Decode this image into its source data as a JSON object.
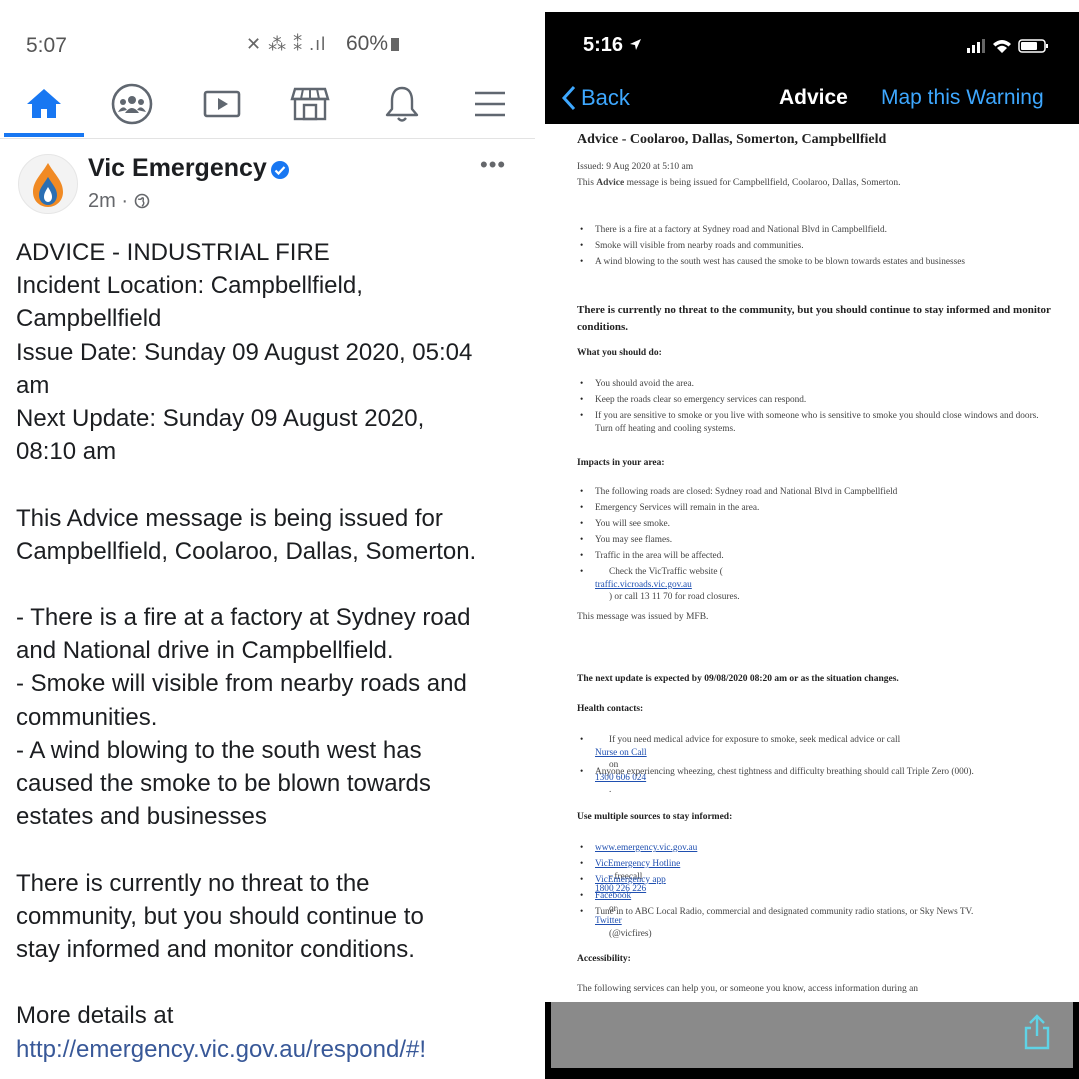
{
  "left": {
    "status": {
      "time": "5:07",
      "icons": "✕ ⁂ ⁑ .ıl",
      "battery": "60%"
    },
    "nav": [
      "home-icon",
      "groups-icon",
      "watch-icon",
      "marketplace-icon",
      "notifications-icon",
      "menu-icon"
    ],
    "post": {
      "page_name": "Vic Emergency",
      "time": "2m · ",
      "more": "•••",
      "lines": [
        "ADVICE - INDUSTRIAL FIRE",
        "Incident Location: Campbellfield,",
        "Campbellfield",
        "Issue Date: Sunday 09 August 2020, 05:04",
        "am",
        "Next Update: Sunday 09 August 2020,",
        "08:10 am",
        "",
        "This Advice message is being issued for",
        "Campbellfield, Coolaroo, Dallas, Somerton.",
        "",
        "- There is a fire at a factory at  Sydney road",
        "and National drive in Campbellfield.",
        "- Smoke will visible from nearby roads and",
        "communities.",
        "- A wind blowing to the south west has",
        "caused the smoke to be blown towards",
        "estates and businesses",
        "",
        "There is currently no threat to the",
        "community, but you should continue to",
        "stay informed and monitor conditions.",
        "",
        "More details at"
      ],
      "link": "http://emergency.vic.gov.au/respond/#!"
    }
  },
  "right": {
    "status": {
      "time": "5:16"
    },
    "nav": {
      "back": "Back",
      "title": "Advice",
      "map": "Map this Warning"
    },
    "doc": {
      "title": "Advice - Coolaroo, Dallas, Somerton, Campbellfield",
      "issued": "Issued: 9 Aug 2020 at 5:10 am",
      "issued_line2_pre": "This ",
      "issued_line2_bold": "Advice",
      "issued_line2_post": " message is being issued for Campbellfield, Coolaroo, Dallas, Somerton.",
      "bullets1": [
        "There is a fire at a factory at  Sydney road and National Blvd in Campbellfield.",
        "Smoke will visible from nearby roads and communities.",
        "A wind blowing to the south west has caused the smoke to be blown towards estates and businesses"
      ],
      "threat": "There is currently no threat to the community, but you should continue to stay informed and monitor conditions.",
      "what_head": "What you should do:",
      "bullets2": [
        "You should avoid the area.",
        "Keep the roads clear so emergency services can respond.",
        "If you are sensitive to smoke or you live with someone who is sensitive to smoke you should close windows and doors. Turn off heating and cooling systems."
      ],
      "impacts_head": "Impacts in your area:",
      "bullets3": [
        "The following roads are closed: Sydney road and National Blvd in Campbellfield",
        "Emergency Services will remain in the area.",
        "You will see smoke.",
        "You may see flames.",
        "Traffic in the area will be affected."
      ],
      "check_pre": "Check the VicTraffic website (",
      "check_link": "traffic.vicroads.vic.gov.au",
      "check_post": ") or call 13 11 70 for road closures.",
      "issued_by": "This message was issued by MFB.",
      "next_update": "The next update is expected by 09/08/2020 08:20 am or as the situation changes.",
      "health_head": "Health contacts:",
      "health1_pre": "If you need medical advice for exposure to smoke, seek medical advice or call ",
      "health1_link": "Nurse on Call",
      "health1_mid": " on ",
      "health1_phone": "1300 606 024",
      "health1_post": ".",
      "health2": "Anyone experiencing wheezing, chest tightness and difficulty breathing should call Triple Zero (000).",
      "sources_head": "Use multiple sources to stay informed:",
      "src1": "www.emergency.vic.gov.au",
      "src2_link": "VicEmergency Hotline",
      "src2_mid": " - freecall ",
      "src2_phone": "1800 226 226",
      "src3": "VicEmergency app",
      "src4_a": "Facebook",
      "src4_mid": " or ",
      "src4_b": "Twitter",
      "src4_post": " (@vicfires)",
      "src5": "Tune in to ABC Local Radio, commercial and designated community radio stations, or Sky News TV.",
      "access_head": "Accessibility:",
      "access_text": "The following services can help you, or someone you know, access information during an"
    }
  }
}
